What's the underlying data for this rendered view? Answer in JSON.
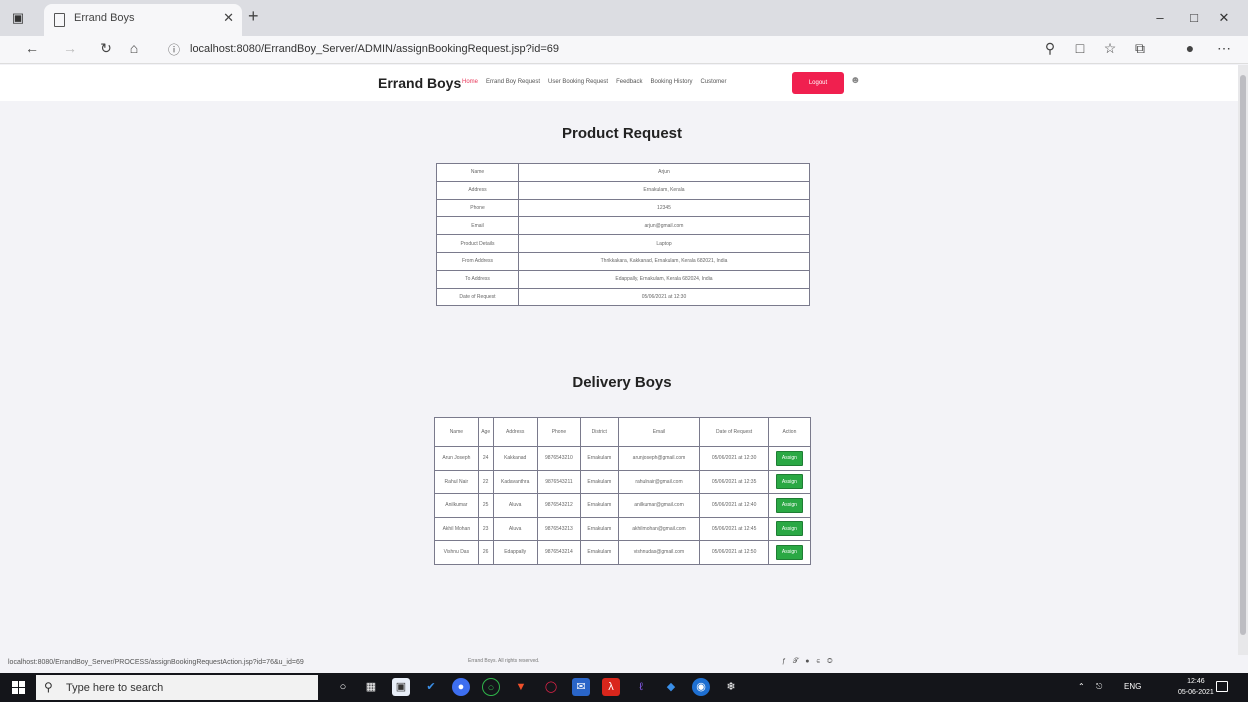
{
  "browser": {
    "tab_title": "Errand Boys",
    "url": "localhost:8080/ErrandBoy_Server/ADMIN/assignBookingRequest.jsp?id=69"
  },
  "site": {
    "brand": "Errand Boys",
    "nav": [
      "Home",
      "Errand Boy Request",
      "User Booking Request",
      "Feedback",
      "Booking History",
      "Customer"
    ],
    "logout_label": "Logout"
  },
  "product_request": {
    "title": "Product Request",
    "rows": [
      {
        "label": "Name",
        "value": "Arjun"
      },
      {
        "label": "Address",
        "value": "Ernakulam, Kerala"
      },
      {
        "label": "Phone",
        "value": "12345"
      },
      {
        "label": "Email",
        "value": "arjun@gmail.com"
      },
      {
        "label": "Product Details",
        "value": "Laptop"
      },
      {
        "label": "From Address",
        "value": "Thrikkakara, Kakkanad, Ernakulam, Kerala 682021, India"
      },
      {
        "label": "To Address",
        "value": "Edappally, Ernakulam, Kerala 682024, India"
      },
      {
        "label": "Date of Request",
        "value": "05/06/2021 at 12:30"
      }
    ]
  },
  "delivery_boys": {
    "title": "Delivery Boys",
    "headers": [
      "Name",
      "Age",
      "Address",
      "Phone",
      "District",
      "Email",
      "Date of Request",
      "Action"
    ],
    "assign_label": "Assign",
    "rows": [
      [
        "Arun Joseph",
        "24",
        "Kakkanad",
        "9876543210",
        "Ernakulam",
        "arunjoseph@gmail.com",
        "05/06/2021 at 12:30"
      ],
      [
        "Rahul Nair",
        "22",
        "Kadavanthra",
        "9876543211",
        "Ernakulam",
        "rahulnair@gmail.com",
        "05/06/2021 at 12:35"
      ],
      [
        "Anilkumar",
        "25",
        "Aluva",
        "9876543212",
        "Ernakulam",
        "anilkumar@gmail.com",
        "05/06/2021 at 12:40"
      ],
      [
        "Akhil Mohan",
        "23",
        "Aluva",
        "9876543213",
        "Ernakulam",
        "akhilmohan@gmail.com",
        "05/06/2021 at 12:45"
      ],
      [
        "Vishnu Das",
        "26",
        "Edappally",
        "9876543214",
        "Ernakulam",
        "vishnudas@gmail.com",
        "05/06/2021 at 12:50"
      ]
    ]
  },
  "statusbar": {
    "link": "localhost:8080/ErrandBoy_Server/PROCESS/assignBookingRequestAction.jsp?id=76&u_id=69",
    "footer": "Errand Boys. All rights reserved."
  },
  "taskbar": {
    "search_placeholder": "Type here to search",
    "lang": "ENG",
    "time": "12:46",
    "date": "05-06-2021"
  }
}
